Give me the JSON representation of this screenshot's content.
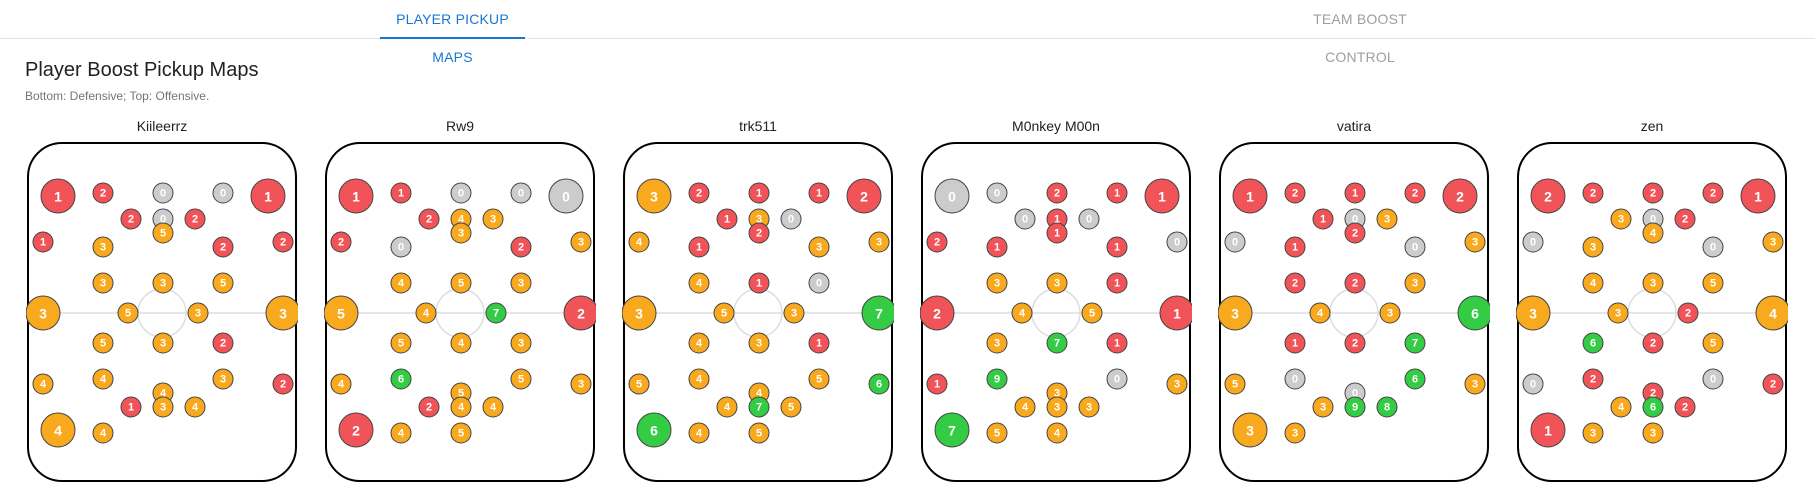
{
  "tabs": [
    {
      "label": "PLAYER PICKUP MAPS",
      "active": true
    },
    {
      "label": "TEAM BOOST CONTROL",
      "active": false
    }
  ],
  "section": {
    "title": "Player Boost Pickup Maps",
    "subtitle": "Bottom: Defensive; Top: Offensive."
  },
  "colors": {
    "red": "#f05459",
    "orange": "#f9a91e",
    "green": "#33cc44",
    "gray": "#cccccc"
  },
  "players": [
    {
      "name": "Kiileerrz",
      "counts": [
        1,
        2,
        0,
        0,
        1,
        2,
        0,
        2,
        1,
        3,
        5,
        2,
        2,
        3,
        3,
        5,
        3,
        5,
        3,
        3,
        5,
        3,
        2,
        4,
        4,
        4,
        3,
        2,
        1,
        3,
        4,
        4,
        4
      ]
    },
    {
      "name": "Rw9",
      "counts": [
        1,
        1,
        0,
        0,
        0,
        2,
        4,
        3,
        2,
        0,
        3,
        2,
        3,
        4,
        5,
        3,
        5,
        4,
        7,
        2,
        5,
        4,
        3,
        4,
        6,
        5,
        5,
        3,
        2,
        4,
        4,
        2,
        4,
        5
      ]
    },
    {
      "name": "trk511",
      "counts": [
        3,
        2,
        1,
        1,
        2,
        1,
        3,
        0,
        4,
        1,
        2,
        3,
        3,
        4,
        1,
        0,
        3,
        5,
        3,
        7,
        4,
        3,
        1,
        5,
        4,
        4,
        5,
        6,
        4,
        7,
        5,
        6,
        4,
        5
      ]
    },
    {
      "name": "M0nkey M00n",
      "counts": [
        0,
        0,
        2,
        1,
        1,
        0,
        1,
        0,
        2,
        1,
        1,
        1,
        0,
        3,
        3,
        1,
        2,
        4,
        5,
        1,
        3,
        7,
        1,
        1,
        9,
        3,
        0,
        3,
        4,
        3,
        3,
        7,
        5,
        4
      ]
    },
    {
      "name": "vatira",
      "counts": [
        1,
        2,
        1,
        2,
        2,
        1,
        0,
        3,
        0,
        1,
        2,
        0,
        3,
        2,
        2,
        3,
        3,
        4,
        3,
        6,
        1,
        2,
        7,
        5,
        0,
        0,
        6,
        3,
        3,
        9,
        8,
        3,
        3
      ]
    },
    {
      "name": "zen",
      "counts": [
        2,
        2,
        2,
        2,
        1,
        3,
        0,
        2,
        0,
        3,
        4,
        0,
        3,
        4,
        3,
        5,
        3,
        3,
        2,
        4,
        6,
        2,
        5,
        0,
        2,
        2,
        0,
        2,
        4,
        6,
        2,
        1,
        3,
        3
      ]
    }
  ]
}
